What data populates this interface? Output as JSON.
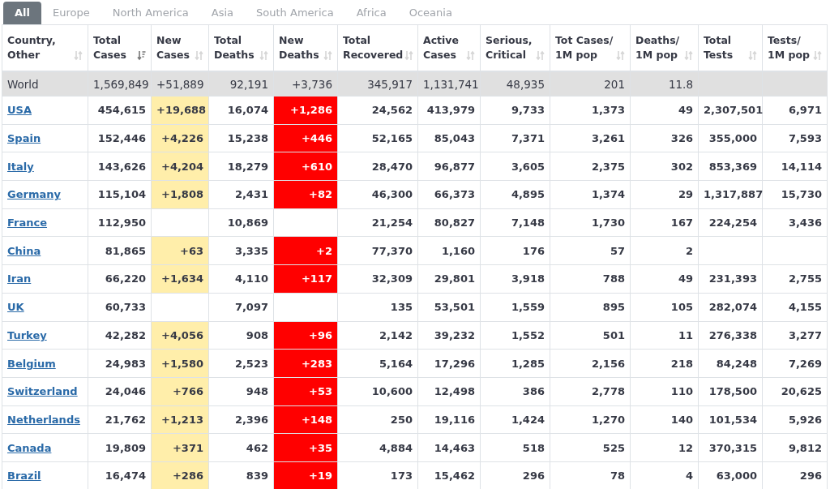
{
  "tabs": [
    {
      "label": "All",
      "selected": true
    },
    {
      "label": "Europe",
      "selected": false
    },
    {
      "label": "North America",
      "selected": false
    },
    {
      "label": "Asia",
      "selected": false
    },
    {
      "label": "South America",
      "selected": false
    },
    {
      "label": "Africa",
      "selected": false
    },
    {
      "label": "Oceania",
      "selected": false
    }
  ],
  "table": {
    "columns": [
      {
        "label": "Country,\nOther",
        "sorted": false
      },
      {
        "label": "Total\nCases",
        "sorted": true
      },
      {
        "label": "New\nCases",
        "sorted": false,
        "color": "#ffeeaa"
      },
      {
        "label": "Total\nDeaths",
        "sorted": false
      },
      {
        "label": "New\nDeaths",
        "sorted": false,
        "color": "#ff0000"
      },
      {
        "label": "Total\nRecovered",
        "sorted": false
      },
      {
        "label": "Active\nCases",
        "sorted": false
      },
      {
        "label": "Serious,\nCritical",
        "sorted": false
      },
      {
        "label": "Tot Cases/\n1M pop",
        "sorted": false
      },
      {
        "label": "Deaths/\n1M pop",
        "sorted": false
      },
      {
        "label": "Total\nTests",
        "sorted": false
      },
      {
        "label": "Tests/\n1M pop",
        "sorted": false
      }
    ],
    "rows": [
      {
        "kind": "total",
        "cells": [
          "World",
          "1,569,849",
          "+51,889",
          "92,191",
          "+3,736",
          "345,917",
          "1,131,741",
          "48,935",
          "201",
          "11.8",
          null,
          null
        ]
      },
      {
        "kind": "country",
        "cells": [
          "USA",
          "454,615",
          "+19,688",
          "16,074",
          "+1,286",
          "24,562",
          "413,979",
          "9,733",
          "1,373",
          "49",
          "2,307,501",
          "6,971"
        ]
      },
      {
        "kind": "country",
        "cells": [
          "Spain",
          "152,446",
          "+4,226",
          "15,238",
          "+446",
          "52,165",
          "85,043",
          "7,371",
          "3,261",
          "326",
          "355,000",
          "7,593"
        ]
      },
      {
        "kind": "country",
        "cells": [
          "Italy",
          "143,626",
          "+4,204",
          "18,279",
          "+610",
          "28,470",
          "96,877",
          "3,605",
          "2,375",
          "302",
          "853,369",
          "14,114"
        ]
      },
      {
        "kind": "country",
        "cells": [
          "Germany",
          "115,104",
          "+1,808",
          "2,431",
          "+82",
          "46,300",
          "66,373",
          "4,895",
          "1,374",
          "29",
          "1,317,887",
          "15,730"
        ]
      },
      {
        "kind": "country",
        "cells": [
          "France",
          "112,950",
          null,
          "10,869",
          null,
          "21,254",
          "80,827",
          "7,148",
          "1,730",
          "167",
          "224,254",
          "3,436"
        ]
      },
      {
        "kind": "country",
        "cells": [
          "China",
          "81,865",
          "+63",
          "3,335",
          "+2",
          "77,370",
          "1,160",
          "176",
          "57",
          "2",
          null,
          null
        ]
      },
      {
        "kind": "country",
        "cells": [
          "Iran",
          "66,220",
          "+1,634",
          "4,110",
          "+117",
          "32,309",
          "29,801",
          "3,918",
          "788",
          "49",
          "231,393",
          "2,755"
        ]
      },
      {
        "kind": "country",
        "cells": [
          "UK",
          "60,733",
          null,
          "7,097",
          null,
          "135",
          "53,501",
          "1,559",
          "895",
          "105",
          "282,074",
          "4,155"
        ]
      },
      {
        "kind": "country",
        "cells": [
          "Turkey",
          "42,282",
          "+4,056",
          "908",
          "+96",
          "2,142",
          "39,232",
          "1,552",
          "501",
          "11",
          "276,338",
          "3,277"
        ]
      },
      {
        "kind": "country",
        "cells": [
          "Belgium",
          "24,983",
          "+1,580",
          "2,523",
          "+283",
          "5,164",
          "17,296",
          "1,285",
          "2,156",
          "218",
          "84,248",
          "7,269"
        ]
      },
      {
        "kind": "country",
        "cells": [
          "Switzerland",
          "24,046",
          "+766",
          "948",
          "+53",
          "10,600",
          "12,498",
          "386",
          "2,778",
          "110",
          "178,500",
          "20,625"
        ]
      },
      {
        "kind": "country",
        "cells": [
          "Netherlands",
          "21,762",
          "+1,213",
          "2,396",
          "+148",
          "250",
          "19,116",
          "1,424",
          "1,270",
          "140",
          "101,534",
          "5,926"
        ]
      },
      {
        "kind": "country",
        "cells": [
          "Canada",
          "19,809",
          "+371",
          "462",
          "+35",
          "4,884",
          "14,463",
          "518",
          "525",
          "12",
          "370,315",
          "9,812"
        ]
      },
      {
        "kind": "country",
        "cells": [
          "Brazil",
          "16,474",
          "+286",
          "839",
          "+19",
          "173",
          "15,462",
          "296",
          "78",
          "4",
          "63,000",
          "296"
        ]
      }
    ]
  }
}
